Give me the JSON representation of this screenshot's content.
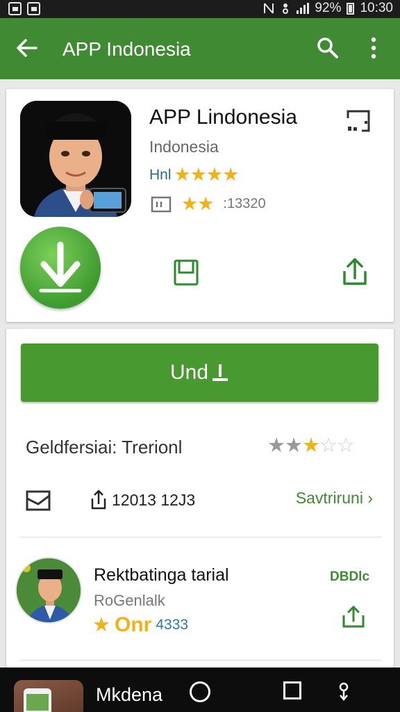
{
  "status_bar": {
    "battery": "92%",
    "time": "10:30"
  },
  "app_bar": {
    "title": "APP Indonesia",
    "back_icon": "arrow-left-icon",
    "search_icon": "search-icon",
    "more_icon": "more-vert-icon"
  },
  "app": {
    "title": "APP Lindonesia",
    "subtitle": "Indonesia",
    "rating_label": "Hnl",
    "rating_stars": "★★★★",
    "review_stars": "★★",
    "review_count": ":13320"
  },
  "actions": {
    "install_label": "Und"
  },
  "details": {
    "category": "Geldfersiai: Trerionl",
    "rating_value": 3,
    "rating_max": 5,
    "downloads": "12013 12J3",
    "see_more": "Savtriruni"
  },
  "review": {
    "title": "Rektbatinga tarial",
    "subtitle": "RoGenlalk",
    "rating_text": "Onr",
    "rating_number": "4333",
    "badge": "DBDlc"
  },
  "nav": {
    "label": "Mkdena"
  },
  "colors": {
    "app_bar": "#3f8a32",
    "accent_green": "#48992f",
    "star_gold": "#f0b21a",
    "status_bar": "#1c1c1c"
  }
}
